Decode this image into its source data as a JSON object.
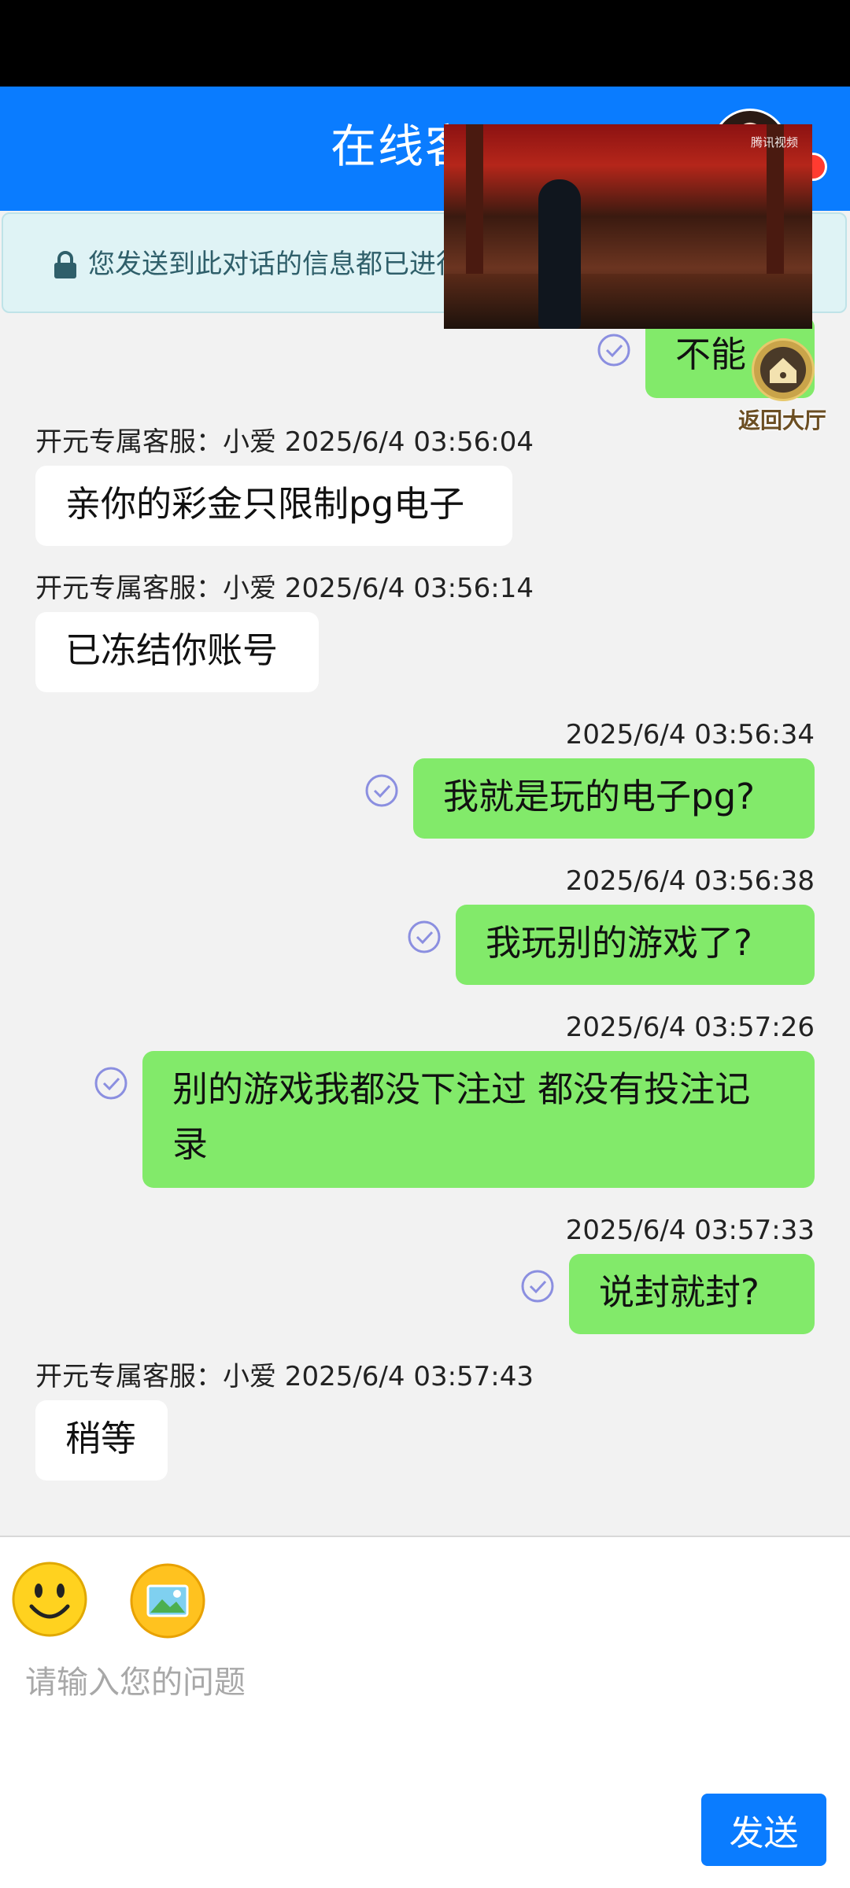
{
  "header": {
    "title": "在线客服"
  },
  "notice": {
    "text": "您发送到此对话的信息都已进行加密保护"
  },
  "top_partial_message": {
    "text": "不能",
    "direction": "out"
  },
  "messages": [
    {
      "direction": "in",
      "meta": "开元专属客服：小爱 2025/6/4 03:56:04",
      "text": "亲你的彩金只限制pg电子"
    },
    {
      "direction": "in",
      "meta": "开元专属客服：小爱 2025/6/4 03:56:14",
      "text": "已冻结你账号"
    },
    {
      "direction": "out",
      "meta": "2025/6/4 03:56:34",
      "text": "我就是玩的电子pg?"
    },
    {
      "direction": "out",
      "meta": "2025/6/4 03:56:38",
      "text": "我玩别的游戏了?"
    },
    {
      "direction": "out",
      "meta": "2025/6/4 03:57:26",
      "text": "别的游戏我都没下注过 都没有投注记录"
    },
    {
      "direction": "out",
      "meta": "2025/6/4 03:57:33",
      "text": "说封就封?"
    },
    {
      "direction": "in",
      "meta": "开元专属客服：小爱 2025/6/4 03:57:43",
      "text": "稍等"
    }
  ],
  "overlay": {
    "video_logo": "腾讯视频",
    "home_label": "返回大厅"
  },
  "composer": {
    "placeholder": "请输入您的问题",
    "value": "",
    "send_label": "发送"
  },
  "colors": {
    "header_bg": "#0a7cff",
    "outgoing_bubble": "#82ea6a",
    "incoming_bubble": "#ffffff",
    "send_button": "#0a7cff"
  },
  "icons": [
    "lock-icon",
    "check-circle-icon",
    "emoji-icon",
    "image-icon",
    "home-icon"
  ]
}
